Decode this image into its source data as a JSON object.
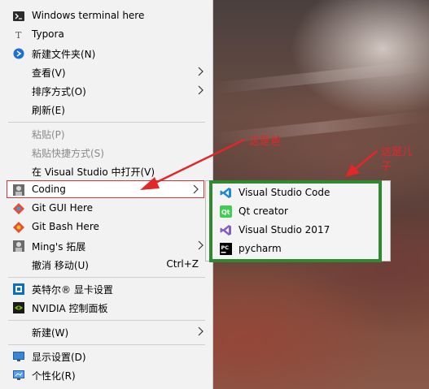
{
  "menu": {
    "items": [
      {
        "label": "Windows terminal here",
        "icon": "terminal-icon"
      },
      {
        "label": "Typora",
        "icon": "typora-icon"
      },
      {
        "label": "新建文件夹(N)",
        "icon": "new-folder-icon"
      },
      {
        "label": "查看(V)",
        "icon": "",
        "submenu": true
      },
      {
        "label": "排序方式(O)",
        "icon": "",
        "submenu": true
      },
      {
        "label": "刷新(E)",
        "icon": ""
      },
      {
        "label": "粘贴(P)",
        "icon": "",
        "disabled": true
      },
      {
        "label": "粘贴快捷方式(S)",
        "icon": "",
        "disabled": true
      },
      {
        "label": "在 Visual Studio 中打开(V)",
        "icon": ""
      },
      {
        "label": "Coding",
        "icon": "coding-icon",
        "submenu": true
      },
      {
        "label": "Git GUI Here",
        "icon": "git-gui-icon"
      },
      {
        "label": "Git Bash Here",
        "icon": "git-bash-icon"
      },
      {
        "label": "Ming's 拓展",
        "icon": "mings-extension-icon",
        "submenu": true
      },
      {
        "label": "撤消 移动(U)",
        "icon": "",
        "accelerator": "Ctrl+Z"
      },
      {
        "label": "英特尔® 显卡设置",
        "icon": "intel-graphics-icon"
      },
      {
        "label": "NVIDIA 控制面板",
        "icon": "nvidia-icon"
      },
      {
        "label": "新建(W)",
        "icon": "",
        "submenu": true
      },
      {
        "label": "显示设置(D)",
        "icon": "display-settings-icon"
      },
      {
        "label": "个性化(R)",
        "icon": "personalize-icon"
      }
    ]
  },
  "submenu": {
    "items": [
      {
        "label": "Visual Studio Code",
        "icon": "vscode-icon"
      },
      {
        "label": "Qt creator",
        "icon": "qt-creator-icon"
      },
      {
        "label": "Visual Studio 2017",
        "icon": "visual-studio-icon"
      },
      {
        "label": "pycharm",
        "icon": "pycharm-icon"
      }
    ]
  },
  "annotations": {
    "parent": "这是爸",
    "child_line1": "这是儿",
    "child_line2": "子"
  },
  "colors": {
    "annotation": "#e02828",
    "frame": "#2f8a2f",
    "highlight_border": "#e03030"
  }
}
